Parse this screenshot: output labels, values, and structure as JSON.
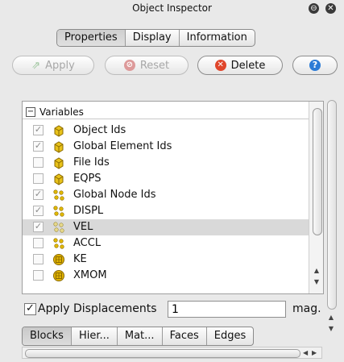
{
  "window": {
    "title": "Object Inspector",
    "icons": [
      "detach-icon",
      "close-icon"
    ]
  },
  "tabs": [
    {
      "label": "Properties",
      "active": true
    },
    {
      "label": "Display",
      "active": false
    },
    {
      "label": "Information",
      "active": false
    }
  ],
  "toolbar": {
    "apply_label": "Apply",
    "reset_label": "Reset",
    "delete_label": "Delete",
    "help_label": "?"
  },
  "variables": {
    "header": "Variables",
    "items": [
      {
        "label": "Object Ids",
        "checked": true,
        "icon": "cell-data-icon"
      },
      {
        "label": "Global Element Ids",
        "checked": true,
        "icon": "cell-data-icon"
      },
      {
        "label": "File Ids",
        "checked": false,
        "icon": "cell-data-icon"
      },
      {
        "label": "EQPS",
        "checked": false,
        "icon": "cell-data-icon"
      },
      {
        "label": "Global Node Ids",
        "checked": true,
        "icon": "point-data-icon"
      },
      {
        "label": "DISPL",
        "checked": true,
        "icon": "point-data-icon"
      },
      {
        "label": "VEL",
        "checked": true,
        "icon": "point-data-icon",
        "selected": true
      },
      {
        "label": "ACCL",
        "checked": false,
        "icon": "point-data-icon"
      },
      {
        "label": "KE",
        "checked": false,
        "icon": "field-data-icon"
      },
      {
        "label": "XMOM",
        "checked": false,
        "icon": "field-data-icon"
      }
    ]
  },
  "displacements": {
    "label": "Apply Displacements",
    "checked": true,
    "value": "1",
    "unit": "mag."
  },
  "bottom_tabs": [
    {
      "label": "Blocks",
      "active": true
    },
    {
      "label": "Hier...",
      "active": false
    },
    {
      "label": "Mat...",
      "active": false
    },
    {
      "label": "Faces",
      "active": false
    },
    {
      "label": "Edges",
      "active": false
    }
  ],
  "colors": {
    "cell_icon": "#e8c21a",
    "point_icon": "#e0b800",
    "delete_x": "#e0462b",
    "help_blue": "#2b7bd6"
  }
}
